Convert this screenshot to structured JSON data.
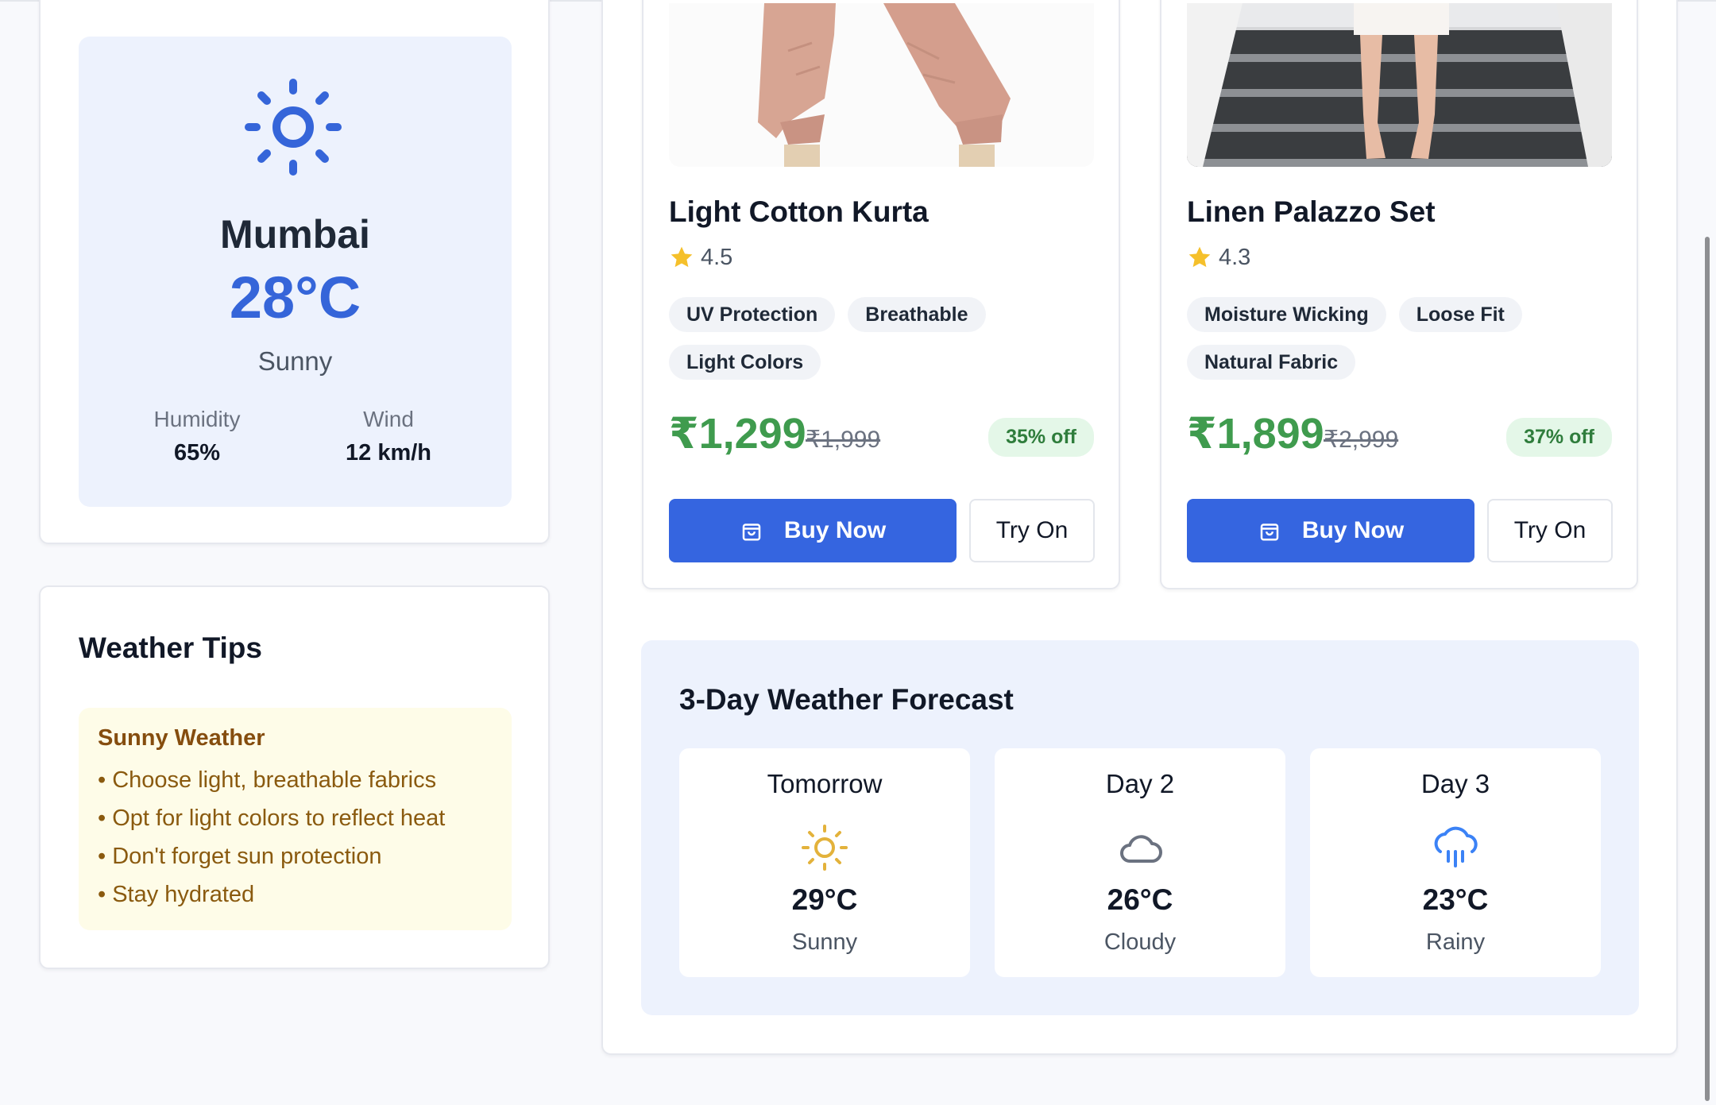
{
  "weather": {
    "city": "Mumbai",
    "temperature": "28°C",
    "condition": "Sunny",
    "humidity_label": "Humidity",
    "humidity_value": "65%",
    "wind_label": "Wind",
    "wind_value": "12 km/h",
    "icon": "sun-icon",
    "accent_color": "#3565d9"
  },
  "tips": {
    "title": "Weather Tips",
    "heading": "Sunny Weather",
    "items": [
      "• Choose light, breathable fabrics",
      "• Opt for light colors to reflect heat",
      "• Don't forget sun protection",
      "• Stay hydrated"
    ]
  },
  "products": [
    {
      "name": "Light Cotton Kurta",
      "rating": "4.5",
      "tags": [
        "UV Protection",
        "Breathable",
        "Light Colors"
      ],
      "price": "₹1,299",
      "mrp": "₹1,999",
      "discount": "35% off",
      "buy_label": "Buy Now",
      "try_label": "Try On"
    },
    {
      "name": "Linen Palazzo Set",
      "rating": "4.3",
      "tags": [
        "Moisture Wicking",
        "Loose Fit",
        "Natural Fabric"
      ],
      "price": "₹1,899",
      "mrp": "₹2,999",
      "discount": "37% off",
      "buy_label": "Buy Now",
      "try_label": "Try On"
    }
  ],
  "forecast": {
    "title": "3-Day Weather Forecast",
    "days": [
      {
        "name": "Tomorrow",
        "temp": "29°C",
        "condition": "Sunny",
        "icon": "sun-icon"
      },
      {
        "name": "Day 2",
        "temp": "26°C",
        "condition": "Cloudy",
        "icon": "cloud-icon"
      },
      {
        "name": "Day 3",
        "temp": "23°C",
        "condition": "Rainy",
        "icon": "rain-cloud-icon"
      }
    ]
  },
  "colors": {
    "primary": "#3565e0",
    "price_green": "#3f9b4e",
    "tips_bg": "#fefce8",
    "forecast_bg": "#edf2fd"
  }
}
